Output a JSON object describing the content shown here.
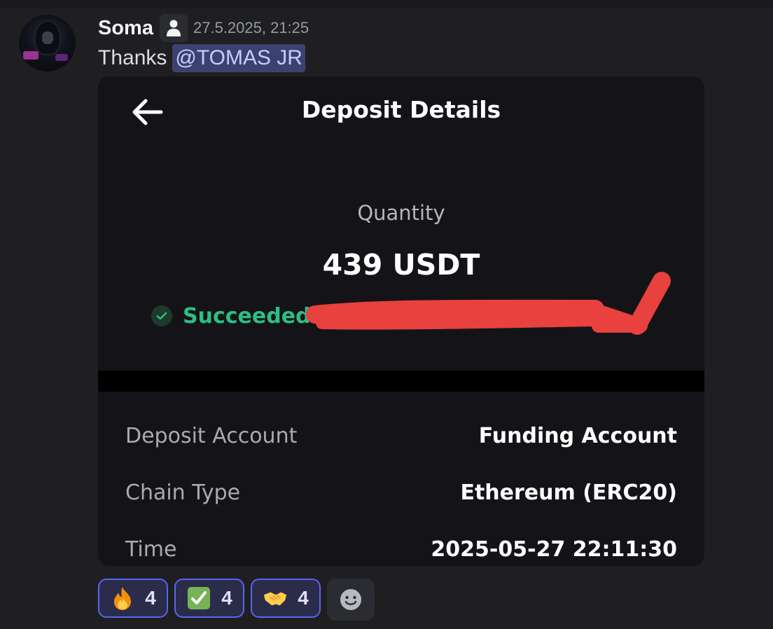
{
  "message": {
    "author": "Soma",
    "timestamp": "27.5.2025, 21:25",
    "text": "Thanks",
    "mention": "@TOMAS JR",
    "avatar_icon": "avatar-hooded-figure"
  },
  "attachment": {
    "title": "Deposit Details",
    "quantity_label": "Quantity",
    "quantity_value": "439 USDT",
    "status": "Succeeded",
    "status_color": "#2ebd85",
    "details": [
      {
        "label": "Deposit Account",
        "value": "Funding Account"
      },
      {
        "label": "Chain Type",
        "value": "Ethereum (ERC20)"
      },
      {
        "label": "Time",
        "value": "2025-05-27 22:11:30"
      }
    ]
  },
  "reactions": [
    {
      "emoji": "fire-icon",
      "count": "4"
    },
    {
      "emoji": "check-mark-button-icon",
      "count": "4"
    },
    {
      "emoji": "handshake-icon",
      "count": "4"
    }
  ],
  "colors": {
    "background": "#1f1f22",
    "mention_bg": "#3c4270",
    "reaction_border": "#5865f2",
    "redaction": "#e8413e"
  }
}
